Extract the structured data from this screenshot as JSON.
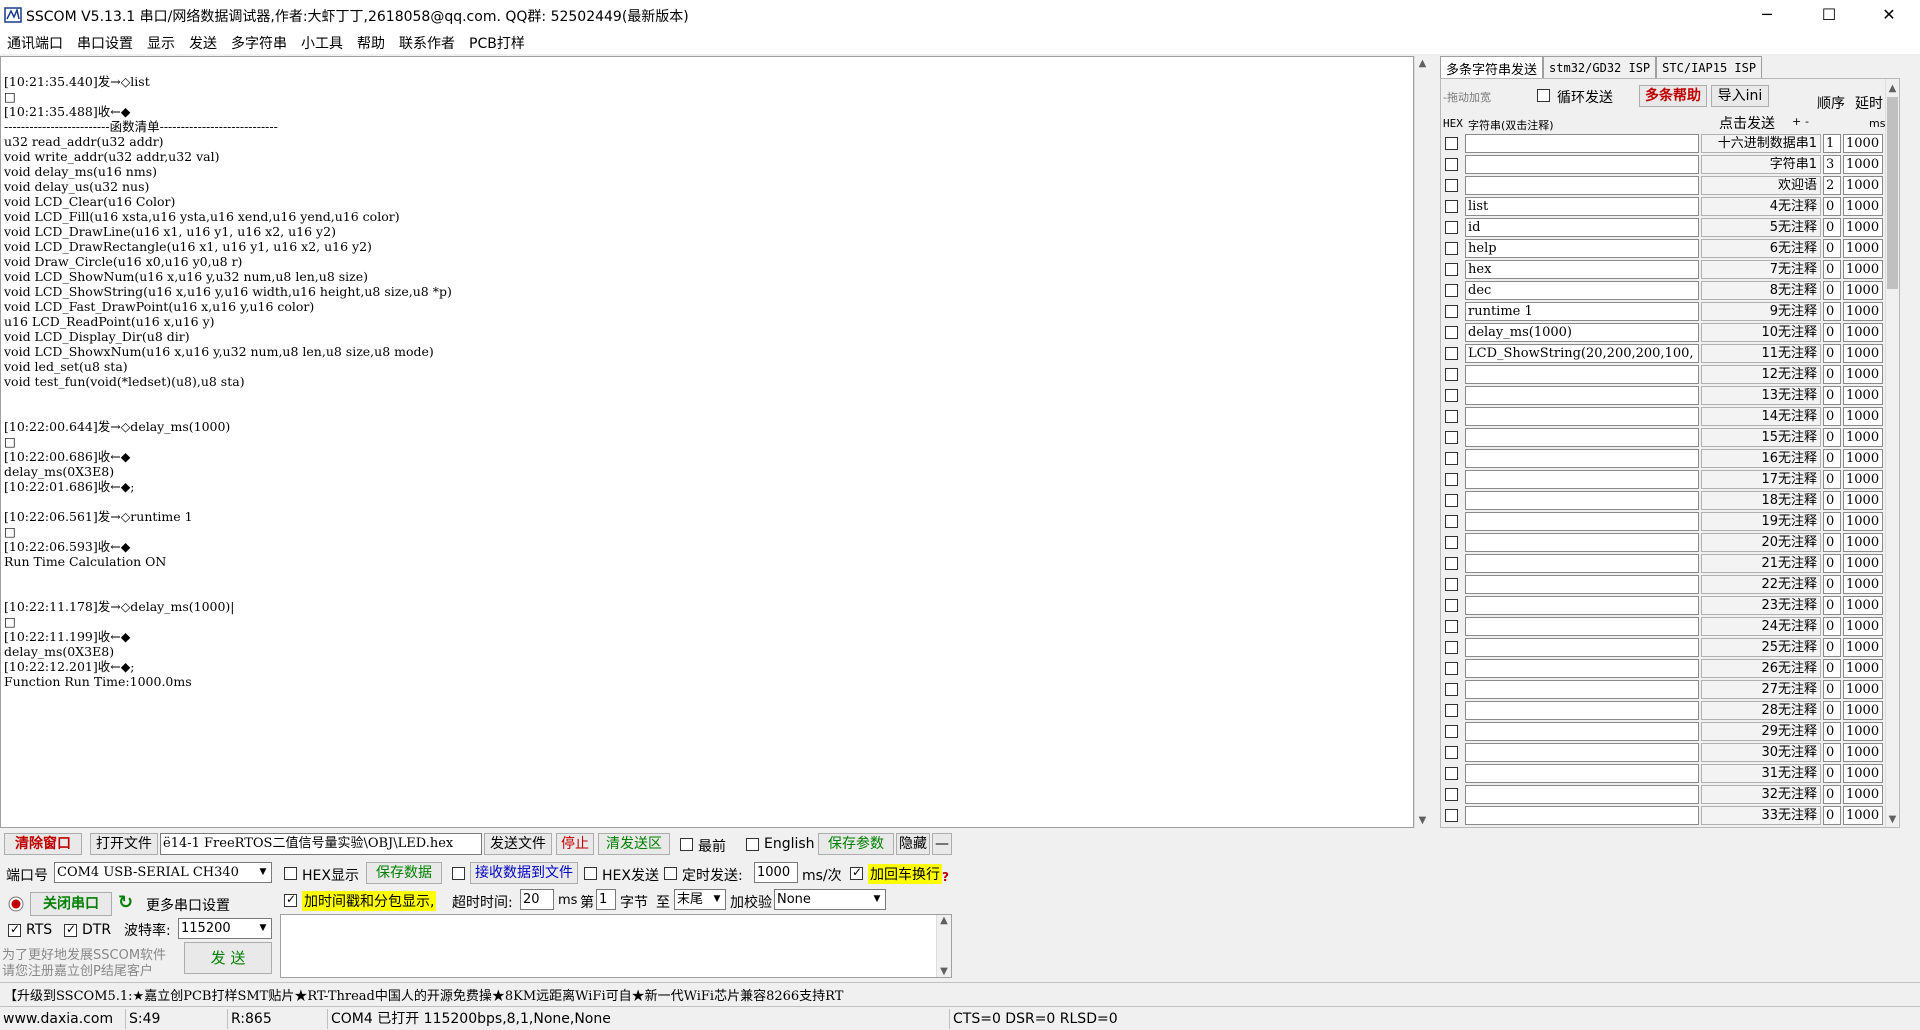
{
  "window": {
    "title": "SSCOM V5.13.1 串口/网络数据调试器,作者:大虾丁丁,2618058@qq.com. QQ群:  52502449(最新版本)",
    "minimize": "─",
    "maximize": "☐",
    "close": "✕"
  },
  "menu": [
    "通讯端口",
    "串口设置",
    "显示",
    "发送",
    "多字符串",
    "小工具",
    "帮助",
    "联系作者",
    "PCB打样"
  ],
  "receive": {
    "lines": [
      "",
      "[10:21:35.440]发→◇list",
      "□",
      "[10:21:35.488]收←◆",
      "-------------------------函数清单----------------------------",
      "u32 read_addr(u32 addr)",
      "void write_addr(u32 addr,u32 val)",
      "void delay_ms(u16 nms)",
      "void delay_us(u32 nus)",
      "void LCD_Clear(u16 Color)",
      "void LCD_Fill(u16 xsta,u16 ysta,u16 xend,u16 yend,u16 color)",
      "void LCD_DrawLine(u16 x1, u16 y1, u16 x2, u16 y2)",
      "void LCD_DrawRectangle(u16 x1, u16 y1, u16 x2, u16 y2)",
      "void Draw_Circle(u16 x0,u16 y0,u8 r)",
      "void LCD_ShowNum(u16 x,u16 y,u32 num,u8 len,u8 size)",
      "void LCD_ShowString(u16 x,u16 y,u16 width,u16 height,u8 size,u8 *p)",
      "void LCD_Fast_DrawPoint(u16 x,u16 y,u16 color)",
      "u16 LCD_ReadPoint(u16 x,u16 y)",
      "void LCD_Display_Dir(u8 dir)",
      "void LCD_ShowxNum(u16 x,u16 y,u32 num,u8 len,u8 size,u8 mode)",
      "void led_set(u8 sta)",
      "void test_fun(void(*ledset)(u8),u8 sta)",
      "",
      "",
      "[10:22:00.644]发→◇delay_ms(1000)",
      "□",
      "[10:22:00.686]收←◆",
      "delay_ms(0X3E8)",
      "[10:22:01.686]收←◆;",
      "",
      "[10:22:06.561]发→◇runtime 1",
      "□",
      "[10:22:06.593]收←◆",
      "Run Time Calculation ON",
      "",
      "",
      "[10:22:11.178]发→◇delay_ms(1000)|",
      "□",
      "[10:22:11.199]收←◆",
      "delay_ms(0X3E8)",
      "[10:22:12.201]收←◆;",
      "Function Run Time:1000.0ms"
    ]
  },
  "right_tabs": [
    "多条字符串发送",
    "stm32/GD32 ISP",
    "STC/IAP15 ISP"
  ],
  "multi": {
    "drag_hint": "-拖动加宽",
    "loop_send": "循环发送",
    "help": "多条帮助",
    "import": "导入ini",
    "order": "顺序",
    "delay": "延时",
    "col_hex": "HEX",
    "col_str": "字符串(双击注释)",
    "col_click": "点击发送",
    "plus": "+",
    "minus": "-",
    "col_ms": "ms",
    "rows": [
      {
        "hex": false,
        "text": "",
        "label": "十六进制数据串1",
        "order": "1",
        "delay": "1000"
      },
      {
        "hex": false,
        "text": "",
        "label": "字符串1",
        "order": "3",
        "delay": "1000"
      },
      {
        "hex": false,
        "text": "",
        "label": "欢迎语",
        "order": "2",
        "delay": "1000"
      },
      {
        "hex": false,
        "text": "list",
        "label": "4无注释",
        "order": "0",
        "delay": "1000"
      },
      {
        "hex": false,
        "text": "id",
        "label": "5无注释",
        "order": "0",
        "delay": "1000"
      },
      {
        "hex": false,
        "text": "help",
        "label": "6无注释",
        "order": "0",
        "delay": "1000"
      },
      {
        "hex": false,
        "text": "hex",
        "label": "7无注释",
        "order": "0",
        "delay": "1000"
      },
      {
        "hex": false,
        "text": "dec",
        "label": "8无注释",
        "order": "0",
        "delay": "1000"
      },
      {
        "hex": false,
        "text": "runtime 1",
        "label": "9无注释",
        "order": "0",
        "delay": "1000"
      },
      {
        "hex": false,
        "text": "delay_ms(1000)",
        "label": "10无注释",
        "order": "0",
        "delay": "1000"
      },
      {
        "hex": false,
        "text": "LCD_ShowString(20,200,200,100,",
        "label": "11无注释",
        "order": "0",
        "delay": "1000"
      },
      {
        "hex": false,
        "text": "",
        "label": "12无注释",
        "order": "0",
        "delay": "1000"
      },
      {
        "hex": false,
        "text": "",
        "label": "13无注释",
        "order": "0",
        "delay": "1000"
      },
      {
        "hex": false,
        "text": "",
        "label": "14无注释",
        "order": "0",
        "delay": "1000"
      },
      {
        "hex": false,
        "text": "",
        "label": "15无注释",
        "order": "0",
        "delay": "1000"
      },
      {
        "hex": false,
        "text": "",
        "label": "16无注释",
        "order": "0",
        "delay": "1000"
      },
      {
        "hex": false,
        "text": "",
        "label": "17无注释",
        "order": "0",
        "delay": "1000"
      },
      {
        "hex": false,
        "text": "",
        "label": "18无注释",
        "order": "0",
        "delay": "1000"
      },
      {
        "hex": false,
        "text": "",
        "label": "19无注释",
        "order": "0",
        "delay": "1000"
      },
      {
        "hex": false,
        "text": "",
        "label": "20无注释",
        "order": "0",
        "delay": "1000"
      },
      {
        "hex": false,
        "text": "",
        "label": "21无注释",
        "order": "0",
        "delay": "1000"
      },
      {
        "hex": false,
        "text": "",
        "label": "22无注释",
        "order": "0",
        "delay": "1000"
      },
      {
        "hex": false,
        "text": "",
        "label": "23无注释",
        "order": "0",
        "delay": "1000"
      },
      {
        "hex": false,
        "text": "",
        "label": "24无注释",
        "order": "0",
        "delay": "1000"
      },
      {
        "hex": false,
        "text": "",
        "label": "25无注释",
        "order": "0",
        "delay": "1000"
      },
      {
        "hex": false,
        "text": "",
        "label": "26无注释",
        "order": "0",
        "delay": "1000"
      },
      {
        "hex": false,
        "text": "",
        "label": "27无注释",
        "order": "0",
        "delay": "1000"
      },
      {
        "hex": false,
        "text": "",
        "label": "28无注释",
        "order": "0",
        "delay": "1000"
      },
      {
        "hex": false,
        "text": "",
        "label": "29无注释",
        "order": "0",
        "delay": "1000"
      },
      {
        "hex": false,
        "text": "",
        "label": "30无注释",
        "order": "0",
        "delay": "1000"
      },
      {
        "hex": false,
        "text": "",
        "label": "31无注释",
        "order": "0",
        "delay": "1000"
      },
      {
        "hex": false,
        "text": "",
        "label": "32无注释",
        "order": "0",
        "delay": "1000"
      },
      {
        "hex": false,
        "text": "",
        "label": "33无注释",
        "order": "0",
        "delay": "1000"
      }
    ]
  },
  "toolbar": {
    "clear_window": "清除窗口",
    "open_file": "打开文件",
    "file_path": "ё14-1 FreeRTOS二值信号量实验\\OBJ\\LED.hex",
    "send_file": "发送文件",
    "stop": "停止",
    "clear_send": "清发送区",
    "topmost": "最前",
    "english": "English",
    "save_params": "保存参数",
    "hide": "隐藏",
    "dash": "—"
  },
  "controls": {
    "port_label": "端口号",
    "port_value": "COM4 USB-SERIAL CH340",
    "hex_display": "HEX显示",
    "save_data": "保存数据",
    "recv_to_file": "接收数据到文件",
    "hex_send": "HEX发送",
    "timed_send": "定时发送:",
    "interval": "1000",
    "interval_unit": "ms/次",
    "add_crlf": "加回车换行",
    "close_port": "关闭串口",
    "more_settings": "更多串口设置",
    "timestamp": "加时间戳和分包显示,",
    "timeout_label": "超时时间:",
    "timeout_value": "20",
    "timeout_unit": "ms",
    "nth": "第",
    "byte_value": "1",
    "byte_label": "字节",
    "to_label": "至",
    "to_value": "末尾",
    "checksum_label": "加校验",
    "checksum_value": "None",
    "rts": "RTS",
    "dtr": "DTR",
    "baud_label": "波特率:",
    "baud_value": "115200",
    "promo_line1": "为了更好地发展SSCOM软件",
    "promo_line2": "请您注册嘉立创P结尾客户",
    "send": "发  送"
  },
  "ticker": "【升级到SSCOM5.1:★嘉立创PCB打样SMT贴片★RT-Thread中国人的开源免费操★8KM远距离WiFi可自★新一代WiFi芯片兼容8266支持RT",
  "status": {
    "website": "www.daxia.com",
    "sent": "S:49",
    "received": "R:865",
    "port_state": "COM4 已打开  115200bps,8,1,None,None",
    "lines": "CTS=0 DSR=0 RLSD=0"
  }
}
